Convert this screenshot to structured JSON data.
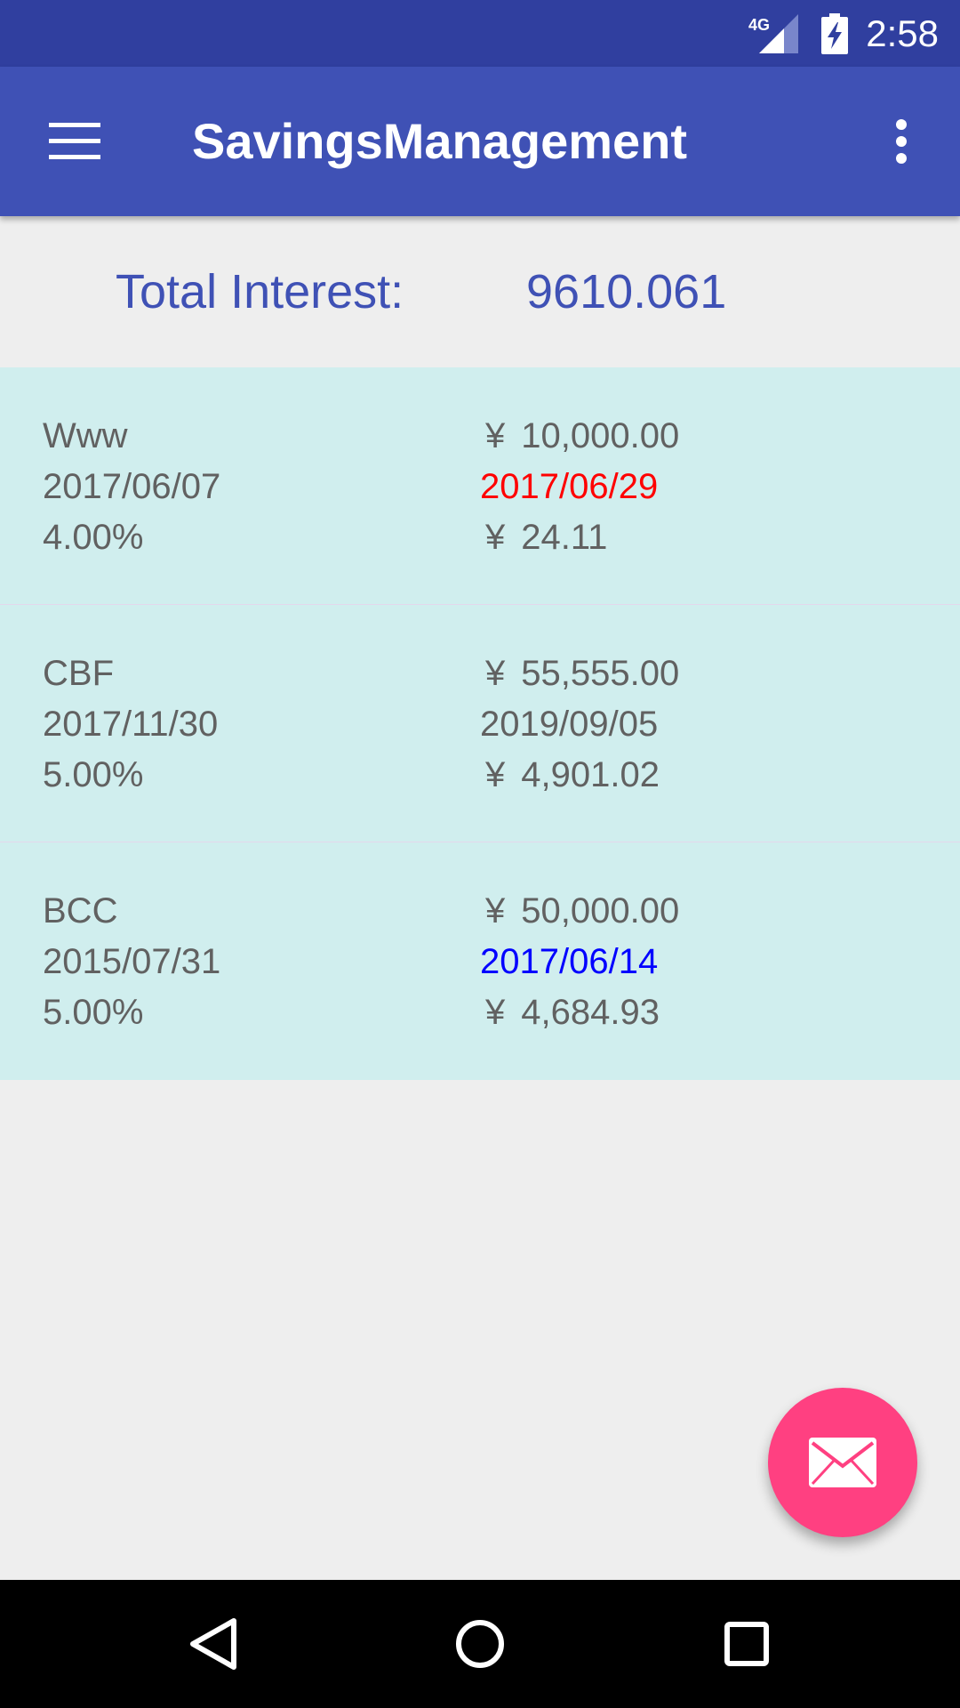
{
  "status_bar": {
    "network": "4G",
    "time": "2:58"
  },
  "app_bar": {
    "title": "SavingsManagement",
    "menu_icon": "hamburger-menu-icon",
    "overflow_icon": "more-vert-icon"
  },
  "summary": {
    "label": "Total Interest:",
    "value": "9610.061"
  },
  "currency_symbol": "¥",
  "items": [
    {
      "name": "Www",
      "start_date": "2017/06/07",
      "rate": "4.00%",
      "amount": "10,000.00",
      "end_date": "2017/06/29",
      "end_date_color": "#ff0000",
      "interest": "24.11"
    },
    {
      "name": "CBF",
      "start_date": "2017/11/30",
      "rate": "5.00%",
      "amount": "55,555.00",
      "end_date": "2019/09/05",
      "end_date_color": "#616161",
      "interest": "4,901.02"
    },
    {
      "name": "BCC",
      "start_date": "2015/07/31",
      "rate": "5.00%",
      "amount": "50,000.00",
      "end_date": "2017/06/14",
      "end_date_color": "#0000ff",
      "interest": "4,684.93"
    }
  ],
  "fab": {
    "icon": "mail-icon",
    "color": "#ff4081"
  },
  "nav_bar": {
    "back_icon": "back-icon",
    "home_icon": "home-icon",
    "recents_icon": "recents-icon"
  },
  "colors": {
    "primary": "#3f51b5",
    "primary_dark": "#303f9f",
    "list_background": "#d0eeee",
    "text": "#616161"
  }
}
